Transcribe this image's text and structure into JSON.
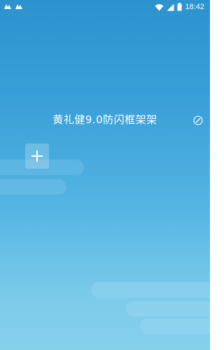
{
  "status_bar": {
    "time": "18:42",
    "icons": [
      "notification-icon",
      "notification-icon",
      "wifi-icon",
      "signal-icon",
      "battery-icon"
    ]
  },
  "app": {
    "title": "黄礼健9.0防闪框架架",
    "edit_icon": "edit-circle-icon",
    "add_icon": "plus-icon"
  },
  "colors": {
    "background_top": "#2d93cf",
    "background_bottom": "#86d0ec",
    "foreground": "#ffffff"
  }
}
